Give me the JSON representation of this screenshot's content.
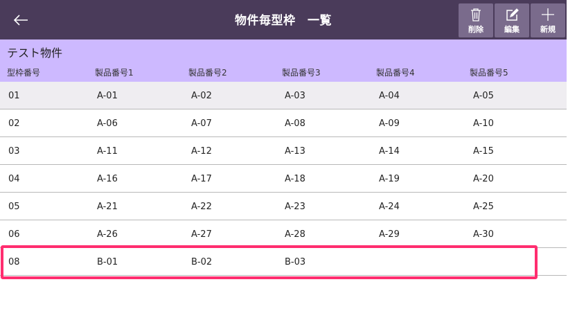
{
  "header": {
    "title": "物件毎型枠　一覧",
    "buttons": {
      "delete": "削除",
      "edit": "編集",
      "new": "新規"
    }
  },
  "project_name": "テスト物件",
  "columns": [
    "型枠番号",
    "製品番号1",
    "製品番号2",
    "製品番号3",
    "製品番号4",
    "製品番号5"
  ],
  "rows": [
    [
      "01",
      "A-01",
      "A-02",
      "A-03",
      "A-04",
      "A-05"
    ],
    [
      "02",
      "A-06",
      "A-07",
      "A-08",
      "A-09",
      "A-10"
    ],
    [
      "03",
      "A-11",
      "A-12",
      "A-13",
      "A-14",
      "A-15"
    ],
    [
      "04",
      "A-16",
      "A-17",
      "A-18",
      "A-19",
      "A-20"
    ],
    [
      "05",
      "A-21",
      "A-22",
      "A-23",
      "A-24",
      "A-25"
    ],
    [
      "06",
      "A-26",
      "A-27",
      "A-28",
      "A-29",
      "A-30"
    ],
    [
      "08",
      "B-01",
      "B-02",
      "B-03",
      "",
      ""
    ]
  ],
  "selected_row": 6,
  "colors": {
    "header": "#4a3b5a",
    "button": "#7a6b8c",
    "column_header": "#cdb9ff",
    "first_row": "#efedf1",
    "highlight": "#ff2d6f"
  },
  "icons": {
    "back": "arrow-left-icon",
    "delete": "trash-icon",
    "edit": "edit-icon",
    "new": "plus-icon"
  }
}
